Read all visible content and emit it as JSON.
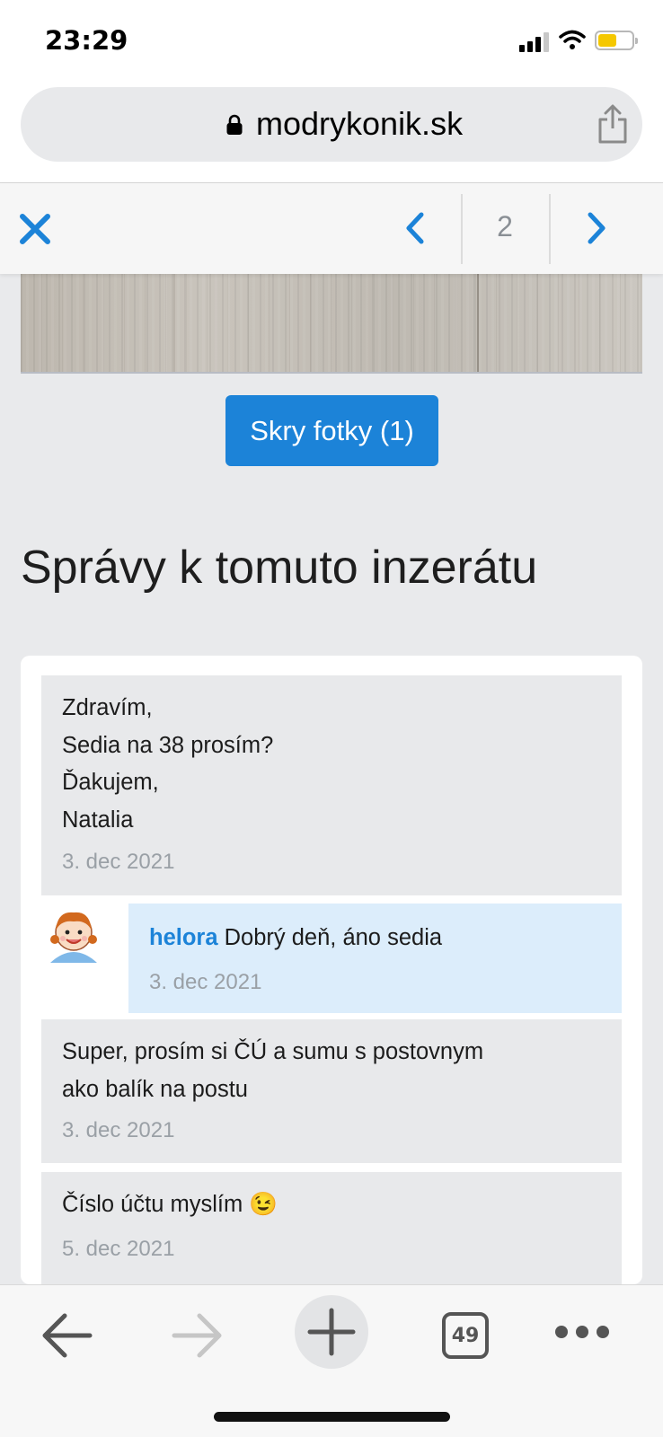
{
  "status_bar": {
    "time": "23:29"
  },
  "browser": {
    "url": "modrykonik.sk"
  },
  "gallery": {
    "page_number": "2"
  },
  "content": {
    "hide_photos_label": "Skry fotky (1)",
    "section_title": "Správy k tomuto inzerátu"
  },
  "messages": [
    {
      "lines": [
        "Zdravím,",
        "Sedia na 38 prosím?",
        "Ďakujem,",
        "Natalia"
      ],
      "date": "3. dec 2021"
    },
    {
      "user": "helora",
      "text": "Dobrý deň, áno sedia",
      "date": "3. dec 2021"
    },
    {
      "lines": [
        "Super, prosím si ČÚ a sumu s postovnym",
        "ako balík na postu"
      ],
      "date": "3. dec 2021"
    },
    {
      "lines": [
        "Číslo účtu myslím 😉"
      ],
      "date": "5. dec 2021"
    }
  ],
  "bottom_bar": {
    "tab_count": "49"
  },
  "colors": {
    "accent": "#1c83d8",
    "reply_bg": "#dcedfb",
    "message_bg": "#e8e9eb"
  }
}
